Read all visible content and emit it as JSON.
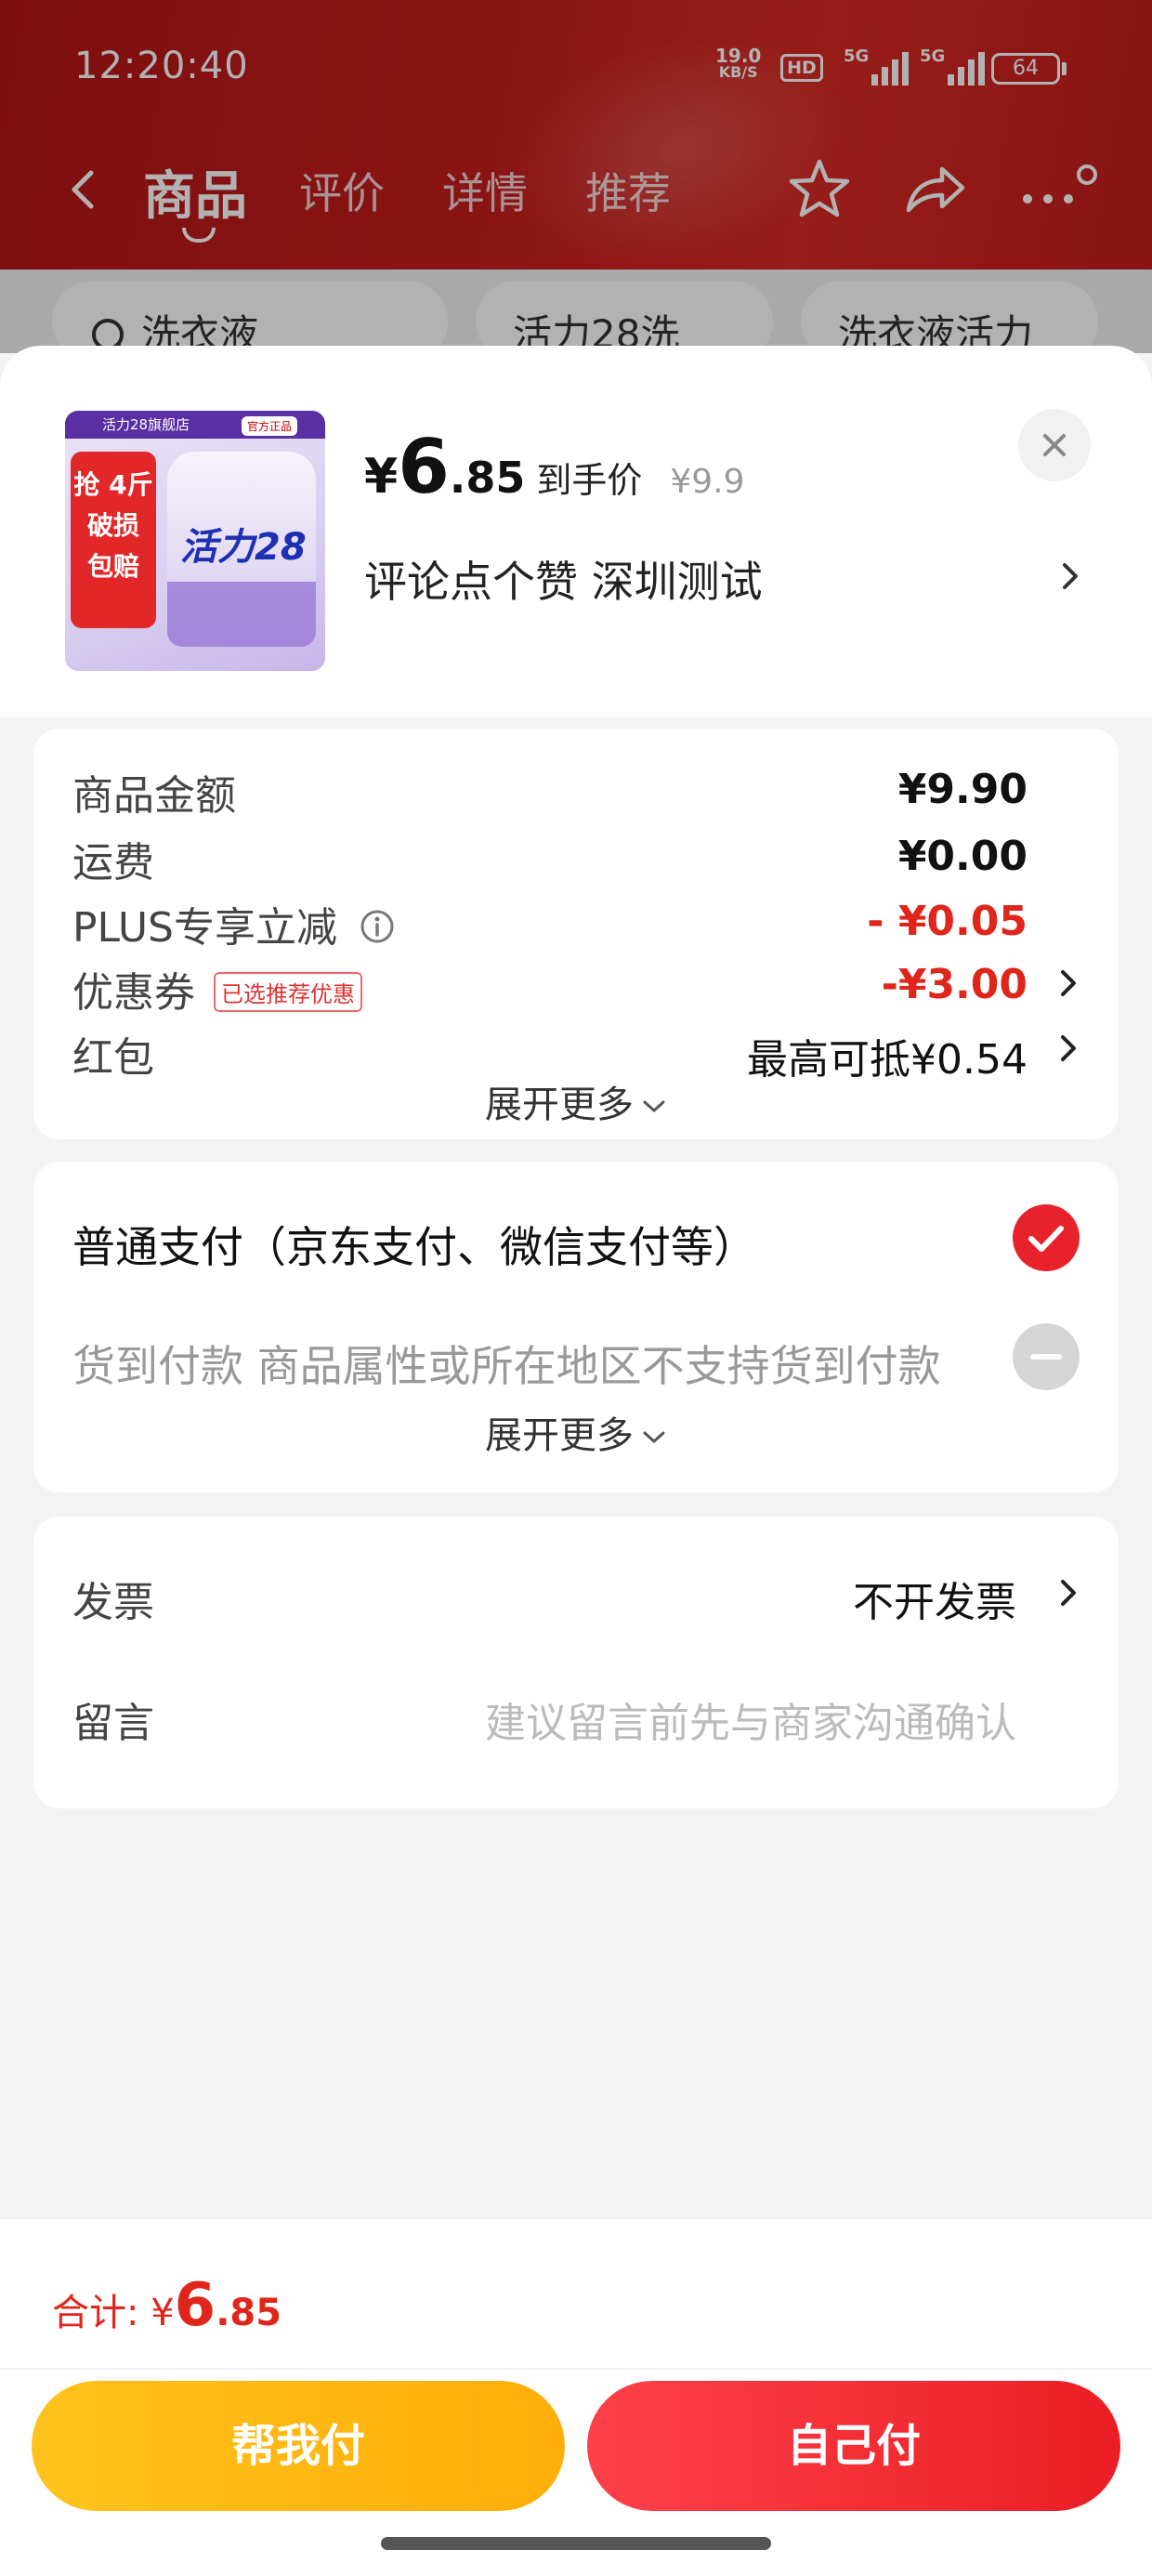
{
  "status": {
    "time": "12:20:40",
    "net_speed": "19.0",
    "net_unit": "KB/S",
    "hd": "HD",
    "sig1": "5G",
    "sig2": "5G",
    "battery": "64"
  },
  "nav": {
    "tabs": [
      "商品",
      "评价",
      "详情",
      "推荐"
    ],
    "active_tab": "商品"
  },
  "search_chips": [
    "洗衣液",
    "活力28洗",
    "洗衣液活力"
  ],
  "product": {
    "image_brand_band": "活力28旗舰店",
    "image_tag": "官方正品",
    "image_promo": "抢 4斤 破损 包赔",
    "image_logo": "活力28",
    "currency": "¥",
    "price_int": "6",
    "price_dec": ".85",
    "price_label": "到手价",
    "original_price": "¥9.9",
    "store_line": "评论点个赞  深圳测试"
  },
  "cost_card": {
    "rows": [
      {
        "label": "商品金额",
        "value": "¥9.90"
      },
      {
        "label": "运费",
        "value": "¥0.00"
      },
      {
        "label": "PLUS专享立减",
        "value": "- ¥0.05"
      },
      {
        "label": "优惠券",
        "badge": "已选推荐优惠",
        "value": "-¥3.00"
      },
      {
        "label": "红包",
        "value": "最高可抵¥0.54"
      }
    ],
    "expand": "展开更多"
  },
  "pay_card": {
    "normal_pay": "普通支付（京东支付、微信支付等）",
    "cod": "货到付款 商品属性或所在地区不支持货到付款",
    "expand": "展开更多"
  },
  "misc_card": {
    "invoice_label": "发票",
    "invoice_value": "不开发票",
    "message_label": "留言",
    "message_placeholder": "建议留言前先与商家沟通确认"
  },
  "footer": {
    "total_label": "合计: ",
    "total_currency": "¥",
    "total_int": "6",
    "total_dec": ".85",
    "help_pay": "帮我付",
    "self_pay": "自己付"
  },
  "colors": {
    "accent_red": "#e0261b",
    "help_btn": "#ffb414",
    "self_btn": "#f22c31",
    "header_red": "#c41d1d"
  }
}
